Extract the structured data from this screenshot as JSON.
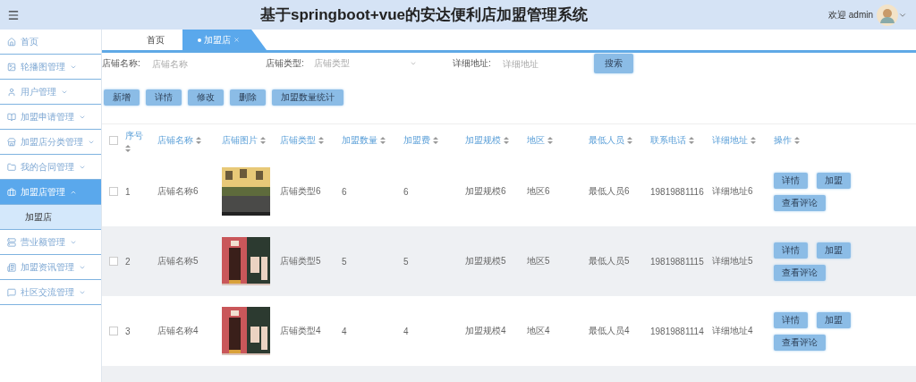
{
  "header": {
    "title": "基于springboot+vue的安达便利店加盟管理系统",
    "welcome": "欢迎 admin"
  },
  "sidebar": {
    "items": [
      {
        "label": "首页",
        "selected": false
      },
      {
        "label": "轮播图管理",
        "selected": false,
        "expanded": false
      },
      {
        "label": "用户管理",
        "selected": false,
        "expanded": false
      },
      {
        "label": "加盟申请管理",
        "selected": false,
        "expanded": false
      },
      {
        "label": "加盟店分类管理",
        "selected": false,
        "expanded": false
      },
      {
        "label": "我的合同管理",
        "selected": false,
        "expanded": false
      },
      {
        "label": "加盟店管理",
        "selected": true,
        "expanded": true,
        "children": [
          {
            "label": "加盟店",
            "selected": true
          }
        ]
      },
      {
        "label": "营业额管理",
        "selected": false,
        "expanded": false
      },
      {
        "label": "加盟资讯管理",
        "selected": false,
        "expanded": false
      },
      {
        "label": "社区交流管理",
        "selected": false,
        "expanded": false
      }
    ]
  },
  "tabs": [
    {
      "label": "首页",
      "selected": false
    },
    {
      "label": "加盟店",
      "selected": true
    }
  ],
  "search": {
    "fields": [
      {
        "kind": "input",
        "label": "店铺名称:",
        "placeholder": "店铺名称"
      },
      {
        "kind": "select",
        "label": "店铺类型:",
        "placeholder": "店铺类型"
      },
      {
        "kind": "input",
        "label": "详细地址:",
        "placeholder": "详细地址"
      }
    ],
    "button": "搜索"
  },
  "toolbar": [
    "新增",
    "详情",
    "修改",
    "删除",
    "加盟数量统计"
  ],
  "table": {
    "select_all_checked": false,
    "columns": [
      "序号",
      "店铺名称",
      "店铺图片",
      "店铺类型",
      "加盟数量",
      "加盟费",
      "加盟规模",
      "地区",
      "最低人员",
      "联系电话",
      "详细地址",
      "操作"
    ],
    "rows": [
      {
        "checked": false,
        "cells": [
          "1",
          "店铺名称6",
          {
            "kind": "picture"
          },
          "店铺类型6",
          "6",
          "6",
          "加盟规模6",
          "地区6",
          "最低人员6",
          "19819881116",
          "详细地址6"
        ],
        "actions": [
          "详情",
          "加盟",
          "查看评论"
        ]
      },
      {
        "checked": false,
        "cells": [
          "2",
          "店铺名称5",
          {
            "kind": "picture"
          },
          "店铺类型5",
          "5",
          "5",
          "加盟规模5",
          "地区5",
          "最低人员5",
          "19819881115",
          "详细地址5"
        ],
        "actions": [
          "详情",
          "加盟",
          "查看评论"
        ]
      },
      {
        "checked": false,
        "cells": [
          "3",
          "店铺名称4",
          {
            "kind": "picture"
          },
          "店铺类型4",
          "4",
          "4",
          "加盟规模4",
          "地区4",
          "最低人员4",
          "19819881114",
          "详细地址4"
        ],
        "actions": [
          "详情",
          "加盟",
          "查看评论"
        ]
      }
    ]
  }
}
